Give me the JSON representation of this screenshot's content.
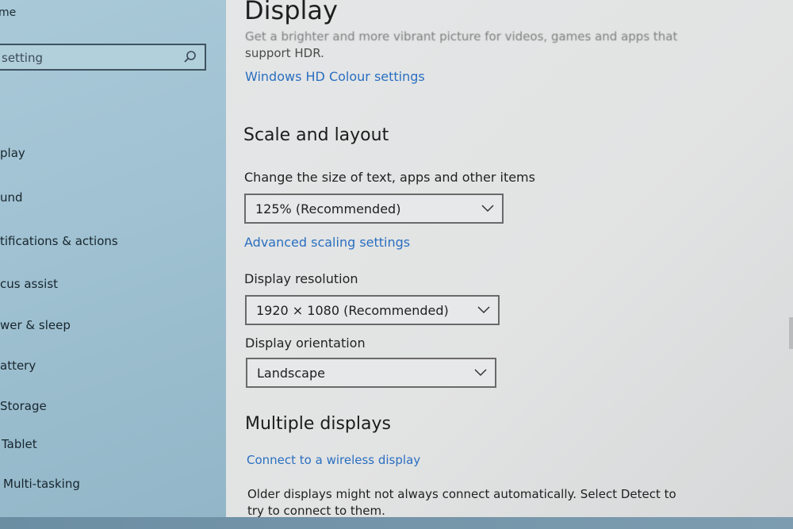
{
  "sidebar": {
    "home_label": "me",
    "search": {
      "placeholder": "setting"
    },
    "items": [
      {
        "label": "play"
      },
      {
        "label": "und"
      },
      {
        "label": "tifications & actions"
      },
      {
        "label": "cus assist"
      },
      {
        "label": "wer & sleep"
      },
      {
        "label": "attery"
      },
      {
        "label": "Storage"
      },
      {
        "label": "Tablet"
      },
      {
        "label": "Multi-tasking"
      }
    ]
  },
  "main": {
    "title": "Display",
    "hdr": {
      "line1": "Get a brighter and more vibrant picture for videos, games and apps that",
      "line2": "support HDR.",
      "link": "Windows HD Colour settings"
    },
    "scale_layout": {
      "title": "Scale and layout",
      "scale_label": "Change the size of text, apps and other items",
      "scale_value": "125% (Recommended)",
      "advanced_link": "Advanced scaling settings",
      "resolution_label": "Display resolution",
      "resolution_value": "1920 × 1080 (Recommended)",
      "orientation_label": "Display orientation",
      "orientation_value": "Landscape"
    },
    "multiple_displays": {
      "title": "Multiple displays",
      "wireless_link": "Connect to a wireless display",
      "description_line1": "Older displays might not always connect automatically. Select Detect to",
      "description_line2": "try to connect to them."
    }
  },
  "colors": {
    "link": "#2a6fc0",
    "sidebar_bg": "#a9c9d8",
    "main_bg": "#e3e5e6"
  },
  "icons": {
    "search": "search-icon",
    "dropdown": "chevron-down-icon"
  }
}
